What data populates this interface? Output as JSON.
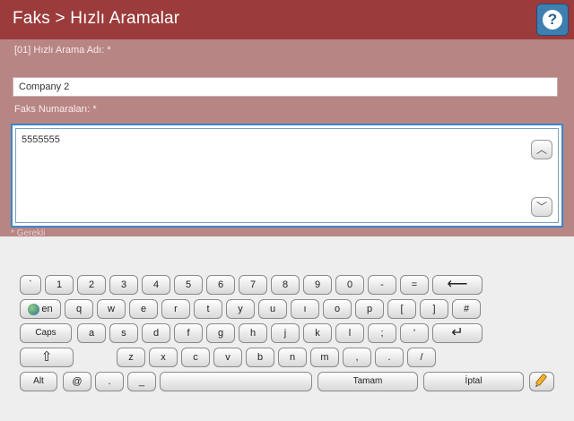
{
  "header": {
    "title": "Faks > Hızlı Aramalar",
    "help_glyph": "?"
  },
  "form": {
    "name_label": "[01] Hızlı Arama Adı: *",
    "name_value": "Company 2",
    "fax_label": "Faks Numaraları: *",
    "fax_value": "5555555",
    "required_note": "* Gerekli"
  },
  "keyboard": {
    "row1": [
      "`",
      "1",
      "2",
      "3",
      "4",
      "5",
      "6",
      "7",
      "8",
      "9",
      "0",
      "-",
      "="
    ],
    "backspace": "⟵",
    "lang": "en",
    "row2": [
      "q",
      "w",
      "e",
      "r",
      "t",
      "y",
      "u",
      "ı",
      "o",
      "p",
      "[",
      "]",
      "#"
    ],
    "caps": "Caps",
    "row3": [
      "a",
      "s",
      "d",
      "f",
      "g",
      "h",
      "j",
      "k",
      "l",
      ";",
      "'"
    ],
    "enter": "↵",
    "shift": "⇧",
    "row4": [
      "z",
      "x",
      "c",
      "v",
      "b",
      "n",
      "m",
      ",",
      ".",
      "/"
    ],
    "alt": "Alt",
    "at": "@",
    "dot": ".",
    "underscore": "_",
    "space": "",
    "ok": "Tamam",
    "cancel": "İptal",
    "edit_icon": "pencil-icon"
  },
  "colors": {
    "header": "#9b3b3b",
    "panel": "#b88585",
    "focus": "#3b86c9"
  }
}
